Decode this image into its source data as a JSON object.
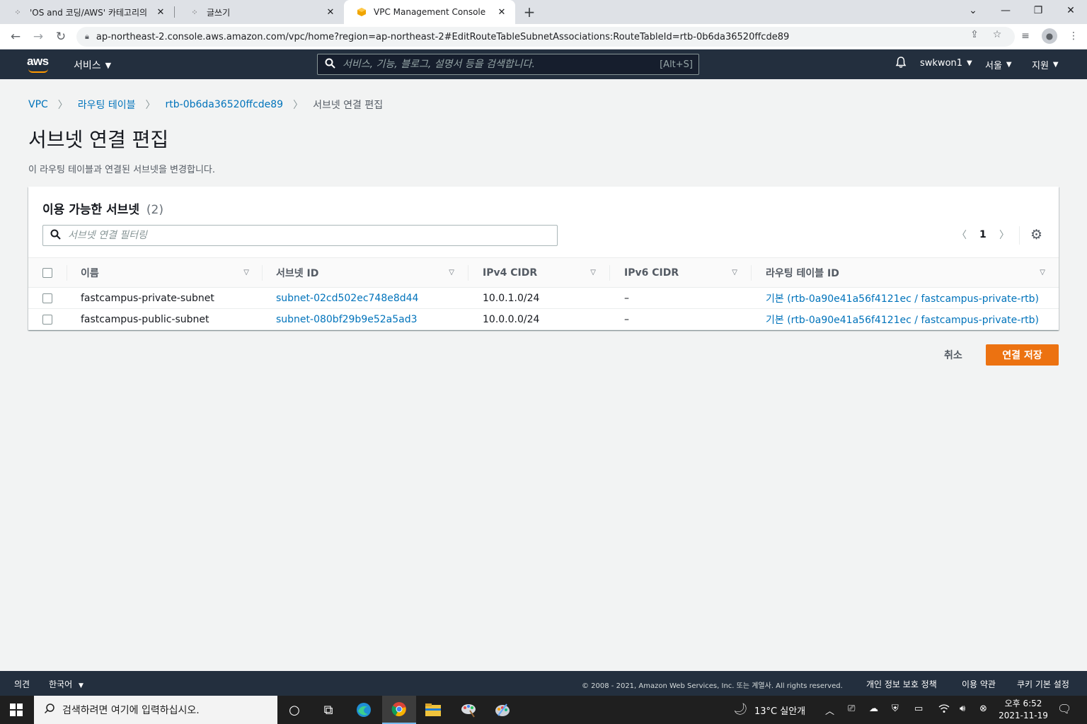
{
  "browser": {
    "tabs": [
      {
        "title": "'OS and 코딩/AWS' 카테고리의",
        "favicon": "tistory"
      },
      {
        "title": "글쓰기",
        "favicon": "tistory"
      },
      {
        "title": "VPC Management Console",
        "favicon": "aws-cube",
        "active": true
      }
    ],
    "url": "ap-northeast-2.console.aws.amazon.com/vpc/home?region=ap-northeast-2#EditRouteTableSubnetAssociations:RouteTableId=rtb-0b6da36520ffcde89"
  },
  "aws_header": {
    "logo": "aws",
    "services_label": "서비스",
    "search_placeholder": "서비스, 기능, 블로그, 설명서 등을 검색합니다.",
    "search_shortcut": "[Alt+S]",
    "user": "swkwon1",
    "region": "서울",
    "support": "지원"
  },
  "breadcrumb": {
    "items": [
      "VPC",
      "라우팅 테이블",
      "rtb-0b6da36520ffcde89"
    ],
    "current": "서브넷 연결 편집"
  },
  "page": {
    "title": "서브넷 연결 편집",
    "description": "이 라우팅 테이블과 연결된 서브넷을 변경합니다."
  },
  "panel": {
    "title": "이용 가능한 서브넷",
    "count": "(2)",
    "filter_placeholder": "서브넷 연결 필터링",
    "page_number": "1",
    "columns": [
      "이름",
      "서브넷 ID",
      "IPv4 CIDR",
      "IPv6 CIDR",
      "라우팅 테이블 ID"
    ],
    "rows": [
      {
        "name": "fastcampus-private-subnet",
        "subnet_id": "subnet-02cd502ec748e8d44",
        "ipv4": "10.0.1.0/24",
        "ipv6": "–",
        "route_table": "기본 (rtb-0a90e41a56f4121ec / fastcampus-private-rtb)"
      },
      {
        "name": "fastcampus-public-subnet",
        "subnet_id": "subnet-080bf29b9e52a5ad3",
        "ipv4": "10.0.0.0/24",
        "ipv6": "–",
        "route_table": "기본 (rtb-0a90e41a56f4121ec / fastcampus-private-rtb)"
      }
    ]
  },
  "actions": {
    "cancel": "취소",
    "save": "연결 저장"
  },
  "footer": {
    "feedback": "의견",
    "language": "한국어",
    "copyright": "© 2008 - 2021, Amazon Web Services, Inc. 또는 계열사. All rights reserved.",
    "privacy": "개인 정보 보호 정책",
    "terms": "이용 약관",
    "cookies": "쿠키 기본 설정"
  },
  "taskbar": {
    "search_placeholder": "검색하려면 여기에 입력하십시오.",
    "weather": "13°C  실안개",
    "time": "오후 6:52",
    "date": "2021-11-19"
  },
  "colors": {
    "aws_nav": "#232f3e",
    "link": "#0073bb",
    "primary_button": "#ec7211",
    "page_bg": "#f2f3f3"
  }
}
